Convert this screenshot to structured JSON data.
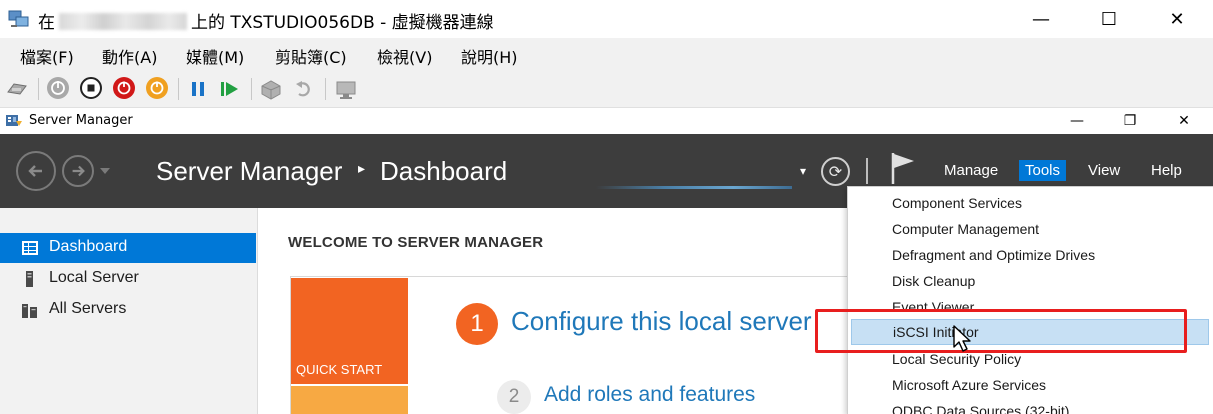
{
  "vm_window": {
    "title_prefix": "在",
    "title_suffix": "上的 TXSTUDIO056DB - 虛擬機器連線",
    "controls": {
      "minimize": "—",
      "maximize": "☐",
      "close": "✕"
    }
  },
  "vm_menu": [
    {
      "label": "檔案(F)"
    },
    {
      "label": "動作(A)"
    },
    {
      "label": "媒體(M)"
    },
    {
      "label": "剪貼簿(C)"
    },
    {
      "label": "檢視(V)"
    },
    {
      "label": "說明(H)"
    }
  ],
  "vm_toolbar": {
    "buttons": [
      {
        "name": "ctrl-alt-del-icon",
        "color": "#8a8a8a"
      },
      {
        "name": "start-icon",
        "color": "#9a9a9a"
      },
      {
        "name": "turn-off-icon",
        "color": "#222222"
      },
      {
        "name": "shut-down-icon",
        "color": "#d11818"
      },
      {
        "name": "save-icon",
        "color": "#f0a020"
      },
      {
        "name": "pause-icon",
        "color": "#1a73c7"
      },
      {
        "name": "reset-icon",
        "color": "#22a042"
      },
      {
        "name": "checkpoint-icon",
        "color": "#9a9a9a"
      },
      {
        "name": "revert-icon",
        "color": "#9a9a9a"
      },
      {
        "name": "enhanced-session-icon",
        "color": "#9a9a9a"
      }
    ]
  },
  "sm_window": {
    "title": "Server Manager",
    "controls": {
      "minimize": "—",
      "restore": "❐",
      "close": "✕"
    }
  },
  "header": {
    "title": "Server Manager",
    "separator": "▸",
    "page": "Dashboard",
    "refresh_dropdown": "▾",
    "refresh_symbol": "⟳",
    "menus": {
      "manage": "Manage",
      "tools": "Tools",
      "view": "View",
      "help": "Help"
    }
  },
  "sidebar": {
    "items": [
      {
        "label": "Dashboard",
        "icon": "dashboard-icon",
        "active": true
      },
      {
        "label": "Local Server",
        "icon": "server-icon",
        "active": false
      },
      {
        "label": "All Servers",
        "icon": "servers-icon",
        "active": false
      }
    ]
  },
  "main": {
    "welcome": "WELCOME TO SERVER MANAGER",
    "quick_start": "QUICK START",
    "step1_number": "1",
    "step1_text": "Configure this local server",
    "step2_number": "2",
    "step2_text": "Add roles and features"
  },
  "tools_menu": {
    "items": [
      {
        "label": "Component Services"
      },
      {
        "label": "Computer Management"
      },
      {
        "label": "Defragment and Optimize Drives"
      },
      {
        "label": "Disk Cleanup"
      },
      {
        "label": "Event Viewer"
      },
      {
        "label": "iSCSI Initiator",
        "highlighted": true
      },
      {
        "label": "Local Security Policy"
      },
      {
        "label": "Microsoft Azure Services"
      },
      {
        "label": "ODBC Data Sources (32-bit)"
      }
    ]
  },
  "colors": {
    "accent": "#0078d7",
    "header_bg": "#3d3d3d",
    "quick_start": "#f26422",
    "link": "#1f78b9",
    "highlight_box": "#e81e1e"
  }
}
